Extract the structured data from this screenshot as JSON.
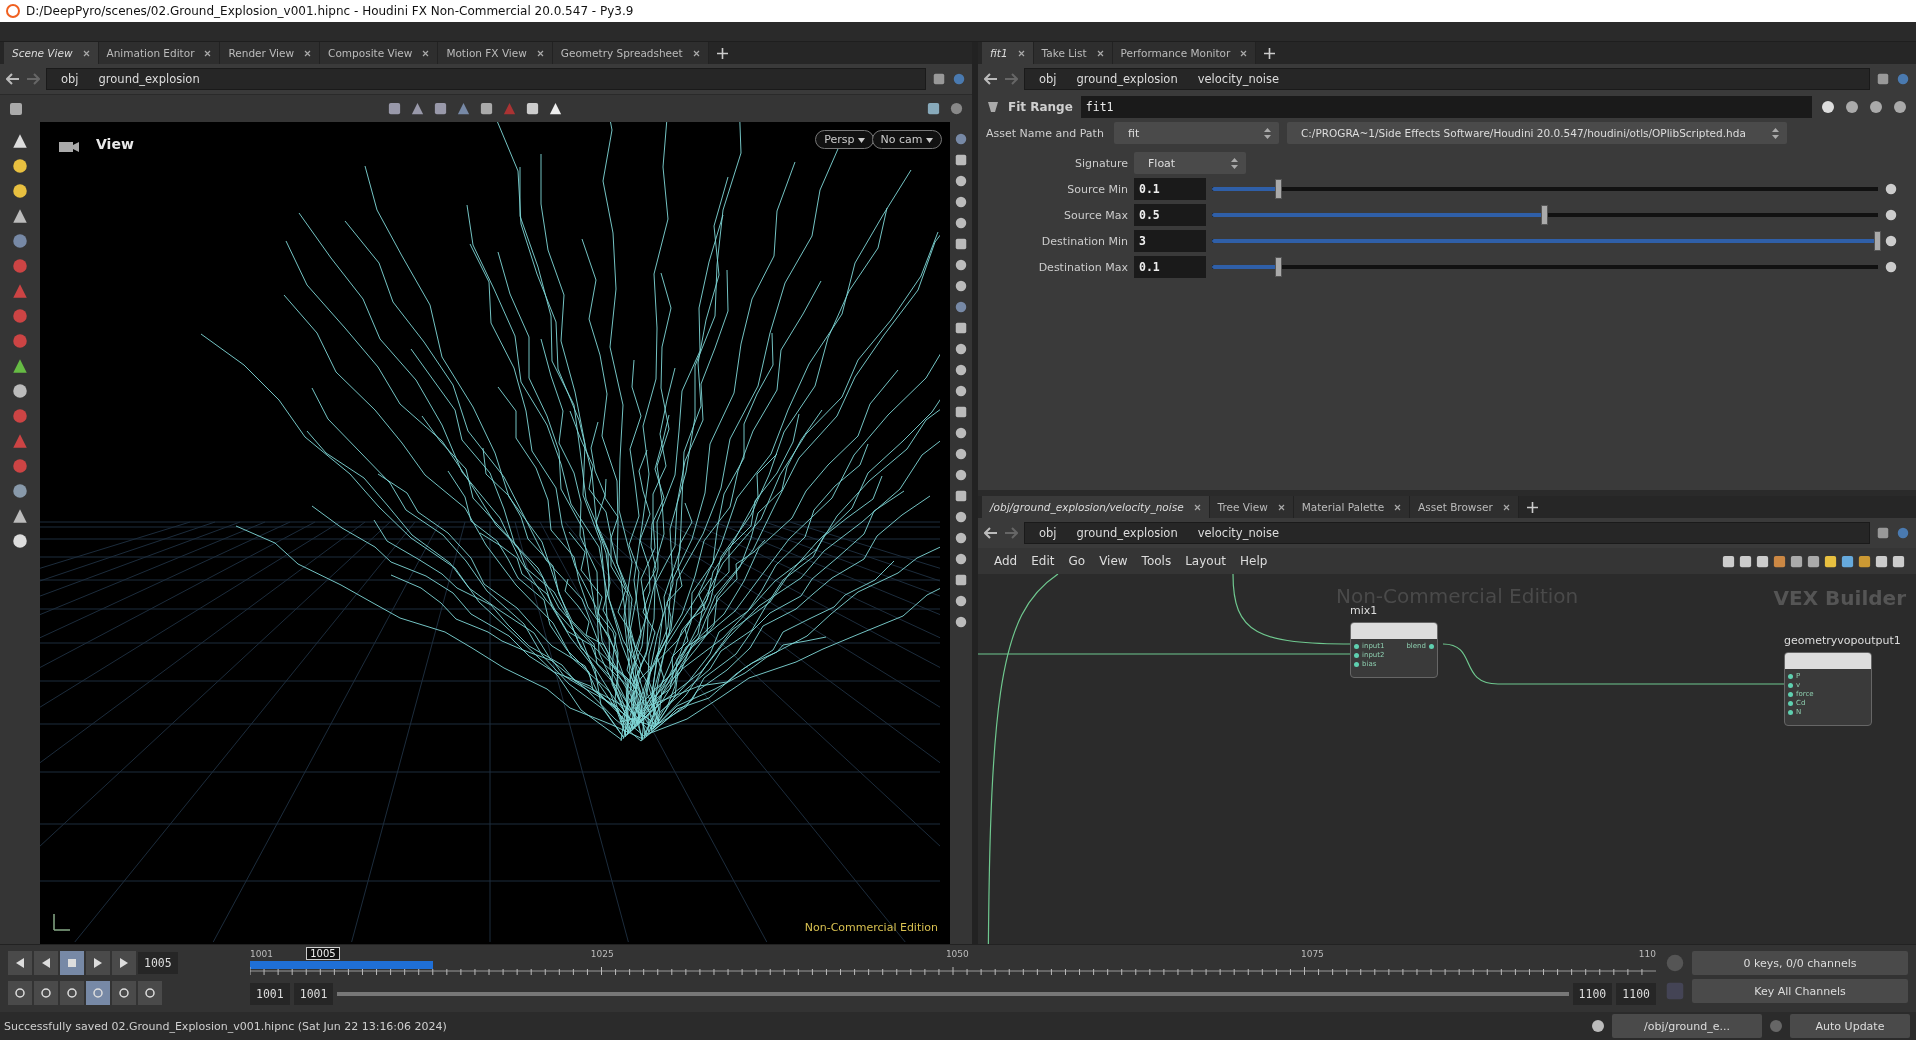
{
  "window": {
    "title": "D:/DeepPyro/scenes/02.Ground_Explosion_v001.hipnc - Houdini FX Non-Commercial 20.0.547 - Py3.9"
  },
  "scene_pane": {
    "tabs": [
      {
        "label": "Scene View",
        "selected": true
      },
      {
        "label": "Animation Editor",
        "selected": false
      },
      {
        "label": "Render View",
        "selected": false
      },
      {
        "label": "Composite View",
        "selected": false
      },
      {
        "label": "Motion FX View",
        "selected": false
      },
      {
        "label": "Geometry Spreadsheet",
        "selected": false
      }
    ],
    "path": [
      "obj",
      "ground_explosion"
    ],
    "viewport": {
      "title": "View",
      "camera_menus": [
        "Persp",
        "No cam"
      ],
      "watermark": "Non-Commercial Edition"
    }
  },
  "parameter_pane": {
    "tabs": [
      {
        "label": "fit1",
        "selected": true
      },
      {
        "label": "Take List",
        "selected": false
      },
      {
        "label": "Performance Monitor",
        "selected": false
      }
    ],
    "path": [
      "obj",
      "ground_explosion",
      "velocity_noise"
    ],
    "node_type": "Fit Range",
    "node_name": "fit1",
    "asset_label": "Asset Name and Path",
    "asset_name": "fit",
    "asset_path": "C:/PROGRA~1/Side Effects Software/Houdini 20.0.547/houdini/otls/OPlibScripted.hda",
    "params": [
      {
        "kind": "menu",
        "label": "Signature",
        "value": "Float"
      },
      {
        "kind": "slider",
        "label": "Source Min",
        "value": "0.1",
        "level": 0.1
      },
      {
        "kind": "slider",
        "label": "Source Max",
        "value": "0.5",
        "level": 0.5
      },
      {
        "kind": "slider",
        "label": "Destination Min",
        "value": "3",
        "level": 1
      },
      {
        "kind": "slider",
        "label": "Destination Max",
        "value": "0.1",
        "level": 0.1
      }
    ]
  },
  "network_pane": {
    "tabs": [
      {
        "label": "/obj/ground_explosion/velocity_noise",
        "selected": true
      },
      {
        "label": "Tree View",
        "selected": false
      },
      {
        "label": "Material Palette",
        "selected": false
      },
      {
        "label": "Asset Browser",
        "selected": false
      }
    ],
    "path": [
      "obj",
      "ground_explosion",
      "velocity_noise"
    ],
    "menu": [
      "Add",
      "Edit",
      "Go",
      "View",
      "Tools",
      "Layout",
      "Help"
    ],
    "watermark": "Non-Commercial Edition",
    "context": "VEX Builder",
    "nodes": [
      {
        "name": "mix1",
        "inputs": [
          "input1",
          "input2",
          "bias"
        ],
        "outputs": [
          "blend"
        ]
      },
      {
        "name": "geometryvopoutput1",
        "inputs": [
          "P",
          "v",
          "force",
          "Cd",
          "N"
        ]
      }
    ]
  },
  "timeline": {
    "frame": "1005",
    "playhead": {
      "label": "1005",
      "level": 0.04
    },
    "cache": {
      "level": 0.13
    },
    "ticks": [
      "1001",
      "1025",
      "1050",
      "1075",
      "110"
    ],
    "range_start": "1001",
    "range_start_2": "1001",
    "range_end": "1100",
    "range_end_2": "1100",
    "keys_info": "0 keys, 0/0 channels",
    "key_menu": "Key All Channels"
  },
  "status_bar": {
    "message": "Successfully saved 02.Ground_Explosion_v001.hipnc (Sat Jun 22 13:16:06 2024)",
    "network_path": "/obj/ground_e...",
    "update_mode": "Auto Update"
  }
}
